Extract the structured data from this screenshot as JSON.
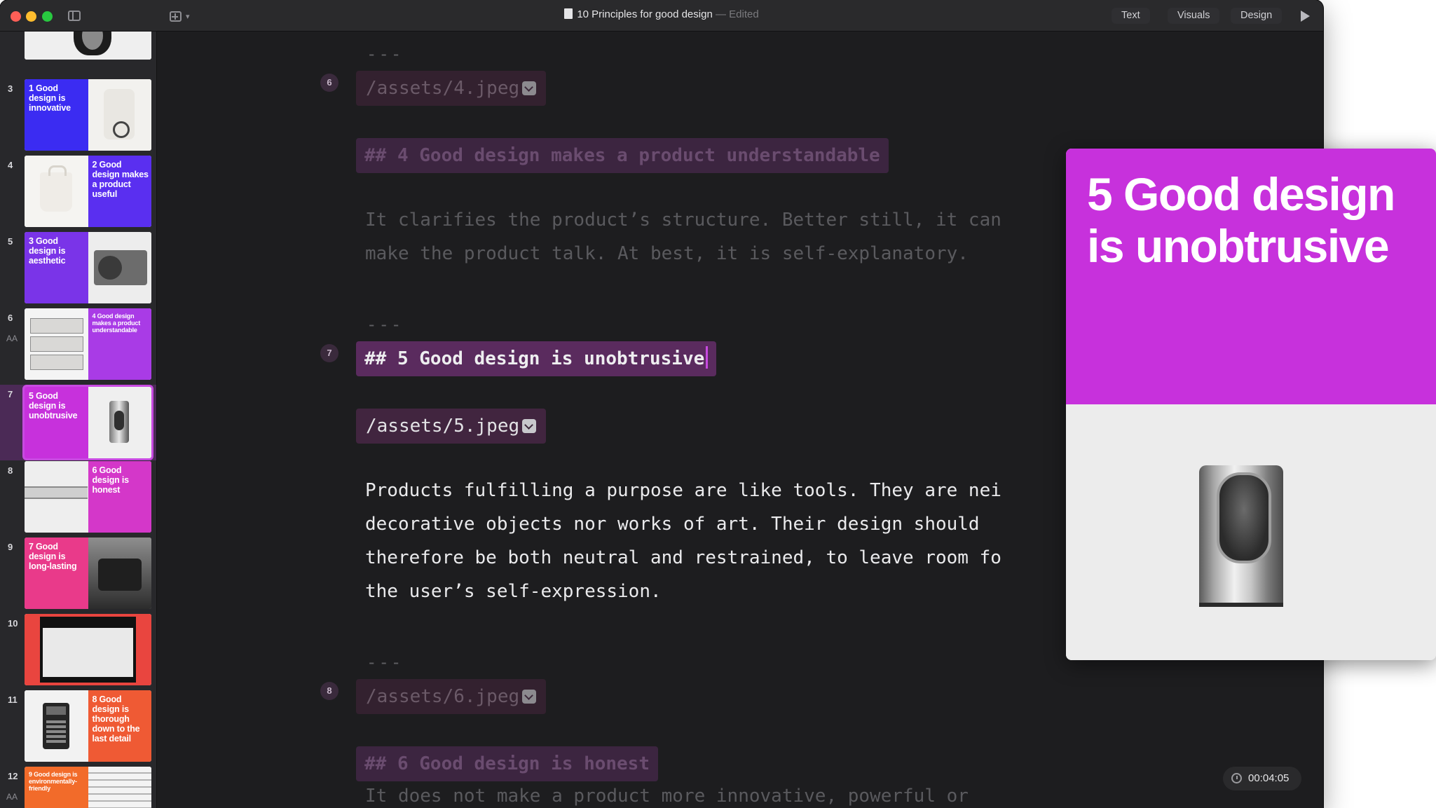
{
  "window": {
    "document_title": "10 Principles for good design",
    "edited_label": "— Edited",
    "tabs": [
      "Text",
      "Visuals",
      "Design"
    ]
  },
  "colors": {
    "accent": "#c731dc",
    "slide_blue": "#3b2cf2",
    "slide_violet": "#7a34e8",
    "slide_magenta": "#c731dc",
    "slide_pink": "#e93a8a",
    "slide_red": "#e9453f",
    "slide_orange": "#f26b2a"
  },
  "sidebar": {
    "thumbnails": [
      {
        "number": "3",
        "title": "1 Good design is innovative"
      },
      {
        "number": "4",
        "title": "2 Good design makes a product useful"
      },
      {
        "number": "5",
        "title": "3 Good design is aesthetic"
      },
      {
        "number": "6",
        "title": "4 Good design makes a product understandable",
        "aa": "AA"
      },
      {
        "number": "7",
        "title": "5 Good design is unobtrusive"
      },
      {
        "number": "8",
        "title": "6 Good design is honest"
      },
      {
        "number": "9",
        "title": "7 Good design is long-lasting"
      },
      {
        "number": "10"
      },
      {
        "number": "11",
        "title": "8 Good design is thorough down to the last detail"
      },
      {
        "number": "12",
        "title": "9 Good design is environmentally-friendly",
        "aa": "AA"
      }
    ]
  },
  "editor": {
    "sep1": "---",
    "marker6": "6",
    "asset4": "/assets/4.jpeg",
    "heading4": "## 4 Good design makes a product understandable",
    "para4_line1": "It clarifies the product’s structure. Better still, it can",
    "para4_line2": "make the product talk. At best, it is self-explanatory.",
    "sep2": "---",
    "marker7": "7",
    "heading5": "## 5 Good design is unobtrusive",
    "asset5": "/assets/5.jpeg",
    "para5_line1": "Products fulfilling a purpose are like tools. They are nei",
    "para5_line2": "decorative objects nor works of art. Their design should",
    "para5_line3": "therefore be both neutral and restrained, to leave room fo",
    "para5_line4": "the user’s self-expression.",
    "sep3": "---",
    "marker8": "8",
    "asset6": "/assets/6.jpeg",
    "heading6": "## 6 Good design is honest",
    "para6_line1": "It does not make a product more innovative, powerful or"
  },
  "preview": {
    "title": "5 Good design is unobtrusive"
  },
  "timer": {
    "value": "00:04:05"
  }
}
